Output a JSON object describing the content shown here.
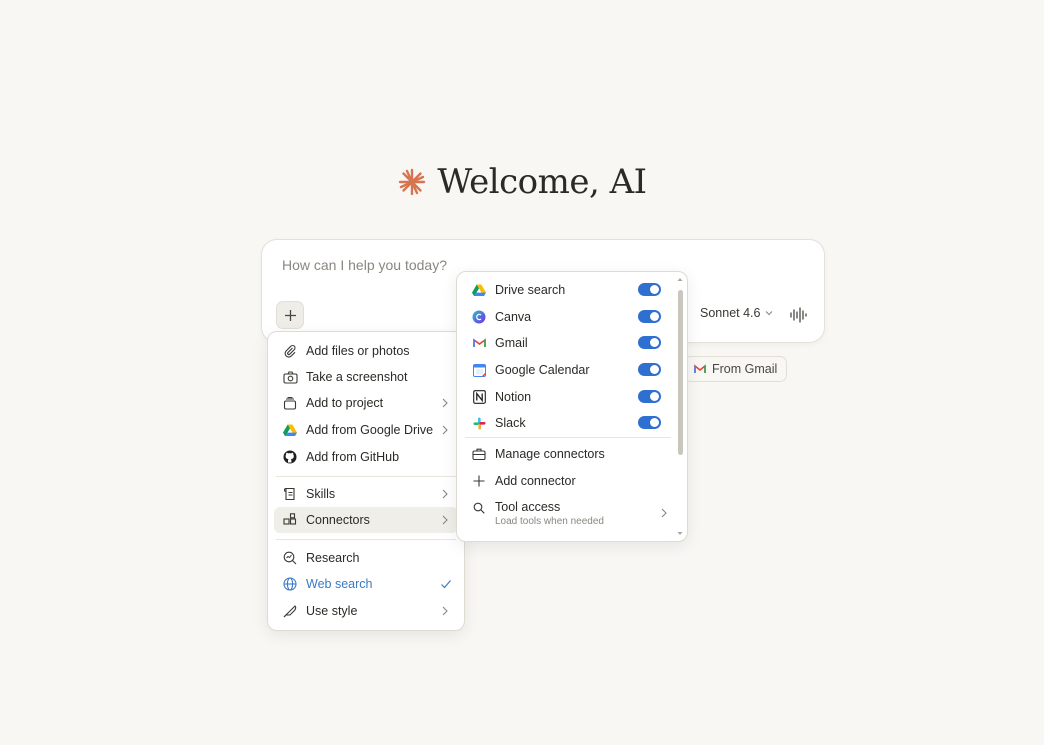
{
  "welcome": {
    "title": "Welcome, AI",
    "logo_icon": "sparkle-icon",
    "accent_color": "#d6754f"
  },
  "composer": {
    "placeholder": "How can I help you today?",
    "model": "Sonnet 4.6",
    "plus_icon": "plus-icon",
    "voice_icon": "voice-waveform-icon"
  },
  "gmail_chip": {
    "label": "From Gmail",
    "icon": "gmail-icon"
  },
  "main_menu": {
    "items": [
      {
        "label": "Add files or photos",
        "icon": "paperclip-icon"
      },
      {
        "label": "Take a screenshot",
        "icon": "camera-icon"
      },
      {
        "label": "Add to project",
        "icon": "project-box-icon"
      },
      {
        "label": "Add from Google Drive",
        "icon": "google-drive-icon"
      },
      {
        "label": "Add from GitHub",
        "icon": "github-icon"
      },
      {
        "label": "Skills",
        "icon": "skills-icon"
      },
      {
        "label": "Connectors",
        "icon": "connectors-icon"
      },
      {
        "label": "Research",
        "icon": "research-icon"
      },
      {
        "label": "Web search",
        "icon": "globe-icon"
      },
      {
        "label": "Use style",
        "icon": "pen-nib-icon"
      }
    ],
    "active_item": "Connectors",
    "checked_item": "Web search"
  },
  "connectors_menu": {
    "items": [
      {
        "label": "Drive search",
        "icon": "google-drive-icon",
        "enabled": true
      },
      {
        "label": "Canva",
        "icon": "canva-icon",
        "enabled": true
      },
      {
        "label": "Gmail",
        "icon": "gmail-icon",
        "enabled": true
      },
      {
        "label": "Google Calendar",
        "icon": "google-calendar-icon",
        "enabled": true
      },
      {
        "label": "Notion",
        "icon": "notion-icon",
        "enabled": true
      },
      {
        "label": "Slack",
        "icon": "slack-icon",
        "enabled": true
      }
    ],
    "actions": [
      {
        "label": "Manage connectors",
        "icon": "toolbox-icon"
      },
      {
        "label": "Add connector",
        "icon": "plus-icon"
      }
    ],
    "tool_access": {
      "label": "Tool access",
      "sublabel": "Load tools when needed",
      "icon": "search-icon"
    },
    "toggle_color": "#2f6fd0"
  }
}
